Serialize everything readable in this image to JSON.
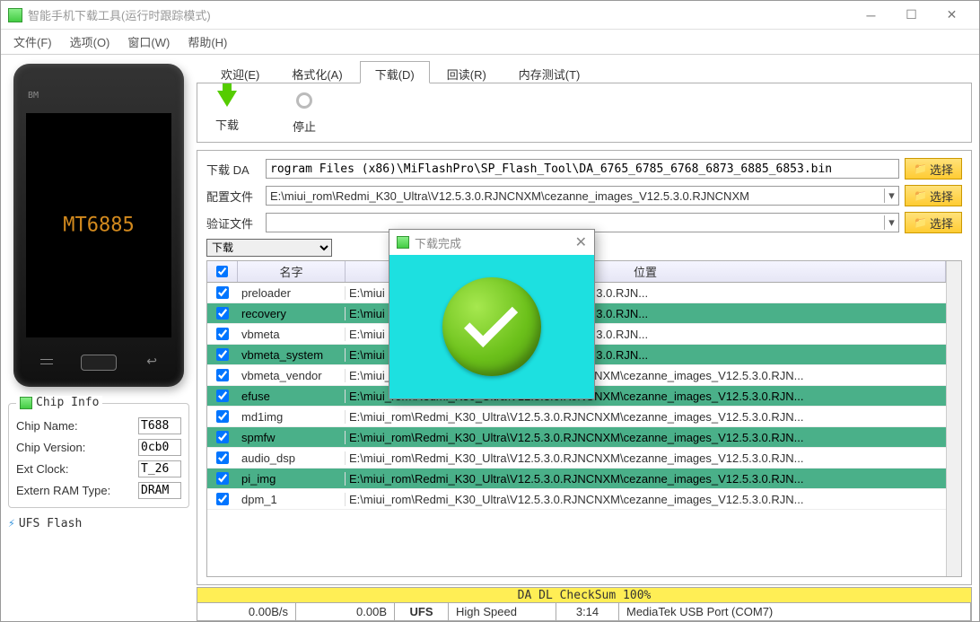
{
  "window": {
    "title": "智能手机下载工具(运行时跟踪模式)"
  },
  "menu": {
    "file": "文件(F)",
    "options": "选项(O)",
    "window": "窗口(W)",
    "help": "帮助(H)"
  },
  "phone": {
    "bm": "BM",
    "chip": "MT6885"
  },
  "chipinfo": {
    "title": "Chip Info",
    "name_label": "Chip Name:",
    "name_val": "T688",
    "ver_label": "Chip Version:",
    "ver_val": "0cb0",
    "ext_label": "Ext Clock:",
    "ext_val": "T_26",
    "ram_label": "Extern RAM Type:",
    "ram_val": "DRAM"
  },
  "ufs": "UFS Flash",
  "tabs": {
    "welcome": "欢迎(E)",
    "format": "格式化(A)",
    "download": "下载(D)",
    "readback": "回读(R)",
    "memtest": "内存测试(T)"
  },
  "toolbar": {
    "download": "下载",
    "stop": "停止"
  },
  "config": {
    "da_label": "下载 DA",
    "da_val": "rogram Files (x86)\\MiFlashPro\\SP_Flash_Tool\\DA_6765_6785_6768_6873_6885_6853.bin",
    "scatter_label": "配置文件",
    "scatter_val": "E:\\miui_rom\\Redmi_K30_Ultra\\V12.5.3.0.RJNCNXM\\cezanne_images_V12.5.3.0.RJNCNXM",
    "auth_label": "验证文件",
    "auth_val": "",
    "mode": "下载",
    "select": "选择"
  },
  "table": {
    "hdr_name": "名字",
    "hdr_loc": "位置",
    "rows": [
      {
        "name": "preloader",
        "loc": "E:\\miui                                                      3.0.RJNCNXM\\cezanne_images_V12.5.3.0.RJN...",
        "g": false
      },
      {
        "name": "recovery",
        "loc": "E:\\miui                                                      3.0.RJNCNXM\\cezanne_images_V12.5.3.0.RJN...",
        "g": true
      },
      {
        "name": "vbmeta",
        "loc": "E:\\miui                                                      3.0.RJNCNXM\\cezanne_images_V12.5.3.0.RJN...",
        "g": false
      },
      {
        "name": "vbmeta_system",
        "loc": "E:\\miui                                                      3.0.RJNCNXM\\cezanne_images_V12.5.3.0.RJN...",
        "g": true
      },
      {
        "name": "vbmeta_vendor",
        "loc": "E:\\miui_rom\\Redmi_K30_Ultra\\V12.5.3.0.RJNCNXM\\cezanne_images_V12.5.3.0.RJN...",
        "g": false
      },
      {
        "name": "efuse",
        "loc": "E:\\miui_rom\\Redmi_K30_Ultra\\V12.5.3.0.RJNCNXM\\cezanne_images_V12.5.3.0.RJN...",
        "g": true
      },
      {
        "name": "md1img",
        "loc": "E:\\miui_rom\\Redmi_K30_Ultra\\V12.5.3.0.RJNCNXM\\cezanne_images_V12.5.3.0.RJN...",
        "g": false
      },
      {
        "name": "spmfw",
        "loc": "E:\\miui_rom\\Redmi_K30_Ultra\\V12.5.3.0.RJNCNXM\\cezanne_images_V12.5.3.0.RJN...",
        "g": true
      },
      {
        "name": "audio_dsp",
        "loc": "E:\\miui_rom\\Redmi_K30_Ultra\\V12.5.3.0.RJNCNXM\\cezanne_images_V12.5.3.0.RJN...",
        "g": false
      },
      {
        "name": "pi_img",
        "loc": "E:\\miui_rom\\Redmi_K30_Ultra\\V12.5.3.0.RJNCNXM\\cezanne_images_V12.5.3.0.RJN...",
        "g": true
      },
      {
        "name": "dpm_1",
        "loc": "E:\\miui_rom\\Redmi_K30_Ultra\\V12.5.3.0.RJNCNXM\\cezanne_images_V12.5.3.0.RJN...",
        "g": false
      }
    ]
  },
  "progress": "DA DL CheckSum 100%",
  "status": {
    "speed": "0.00B/s",
    "size": "0.00B",
    "storage": "UFS",
    "usb": "High Speed",
    "time": "3:14",
    "port": "MediaTek USB Port (COM7)"
  },
  "dialog": {
    "title": "下载完成"
  }
}
